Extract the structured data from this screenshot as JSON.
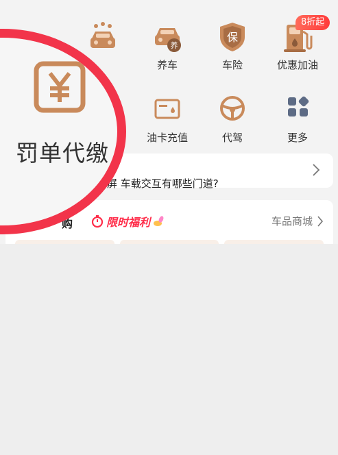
{
  "services": [
    {
      "label": "",
      "icon": "car-wash-icon"
    },
    {
      "label": "养车",
      "icon": "car-maintenance-icon"
    },
    {
      "label": "车险",
      "icon": "insurance-shield-icon"
    },
    {
      "label": "优惠加油",
      "icon": "fuel-pump-icon",
      "badge": "8折起"
    },
    {
      "label": "油卡充值",
      "icon": "fuel-card-icon"
    },
    {
      "label": "代驾",
      "icon": "steering-wheel-icon"
    },
    {
      "label": "更多",
      "icon": "more-grid-icon"
    }
  ],
  "magnifier": {
    "label": "罚单代缴",
    "icon": "yen-icon",
    "ring_color": "#f2344a"
  },
  "news": {
    "title": "屏 车载交互有哪些门道?"
  },
  "shop": {
    "section_title_fragment": "购",
    "flash_sale_label": "限时福利",
    "link_label": "车品商城"
  },
  "colors": {
    "icon_brown": "#c98a5b",
    "accent_red": "#ff2d4a",
    "background": "#f3f3f3"
  }
}
